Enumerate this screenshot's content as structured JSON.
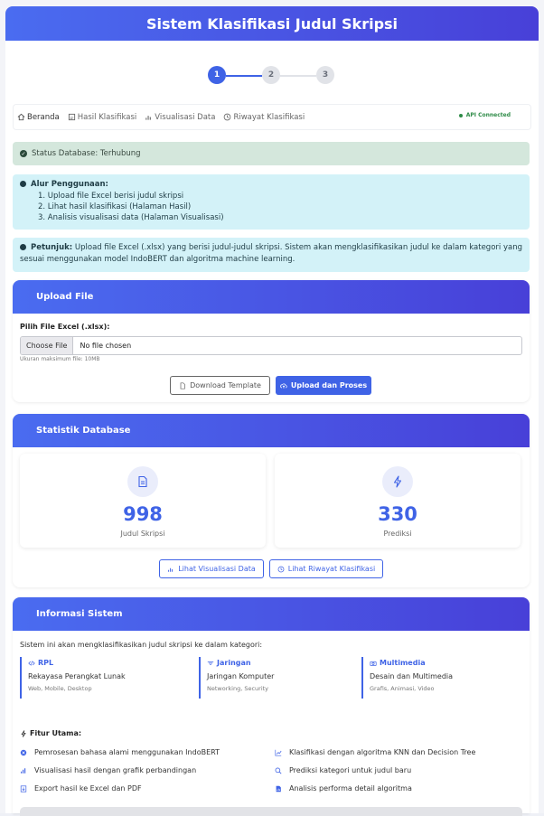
{
  "app_title": "Sistem Klasifikasi Judul Skripsi",
  "stepper": [
    "1",
    "2",
    "3"
  ],
  "nav": {
    "items": [
      {
        "label": "Beranda",
        "icon": "home-icon"
      },
      {
        "label": "Hasil Klasifikasi",
        "icon": "file-icon"
      },
      {
        "label": "Visualisasi Data",
        "icon": "chart-icon"
      },
      {
        "label": "Riwayat Klasifikasi",
        "icon": "clock-icon"
      }
    ],
    "api_status": "API Connected"
  },
  "alerts": {
    "database_status": "Status Database: Terhubung",
    "alur_title": "Alur Penggunaan:",
    "alur_steps": [
      "1. Upload file Excel berisi judul skripsi",
      "2. Lihat hasil klasifikasi (Halaman Hasil)",
      "3. Analisis visualisasi data (Halaman Visualisasi)"
    ],
    "petunjuk_label": "Petunjuk:",
    "petunjuk_text": " Upload file Excel (.xlsx) yang berisi judul-judul skripsi. Sistem akan mengklasifikasikan judul ke dalam kategori yang sesuai menggunakan model IndoBERT dan algoritma machine learning."
  },
  "upload": {
    "title": "Upload File",
    "field_label": "Pilih File Excel (.xlsx):",
    "choose_button": "Choose File",
    "file_status": "No file chosen",
    "hint": "Ukuran maksimum file: 10MB",
    "download_template": "Download Template",
    "upload_process": "Upload dan Proses"
  },
  "stats": {
    "title": "Statistik Database",
    "judul_value": "998",
    "judul_label": "Judul Skripsi",
    "prediksi_value": "330",
    "prediksi_label": "Prediksi",
    "btn_visualisasi": "Lihat Visualisasi Data",
    "btn_riwayat": "Lihat Riwayat Klasifikasi"
  },
  "info": {
    "title": "Informasi Sistem",
    "intro": "Sistem ini akan mengklasifikasikan judul skripsi ke dalam kategori:",
    "categories": [
      {
        "code": "RPL",
        "name": "Rekayasa Perangkat Lunak",
        "desc": "Web, Mobile, Desktop",
        "icon": "code-icon"
      },
      {
        "code": "Jaringan",
        "name": "Jaringan Komputer",
        "desc": "Networking, Security",
        "icon": "network-icon"
      },
      {
        "code": "Multimedia",
        "name": "Desain dan Multimedia",
        "desc": "Grafis, Animasi, Video",
        "icon": "camera-icon"
      }
    ],
    "fitur_title": "Fitur Utama:",
    "features": [
      "Pemrosesan bahasa alami menggunakan IndoBERT",
      "Klasifikasi dengan algoritma KNN dan Decision Tree",
      "Visualisasi hasil dengan grafik perbandingan",
      "Prediksi kategori untuk judul baru",
      "Export hasil ke Excel dan PDF",
      "Analisis performa detail algoritma"
    ]
  },
  "colors": {
    "primary": "#3f63e6",
    "gradient_end": "#4840d8",
    "success_bg": "#d4e7dc",
    "info_bg": "#d3f2f8"
  }
}
